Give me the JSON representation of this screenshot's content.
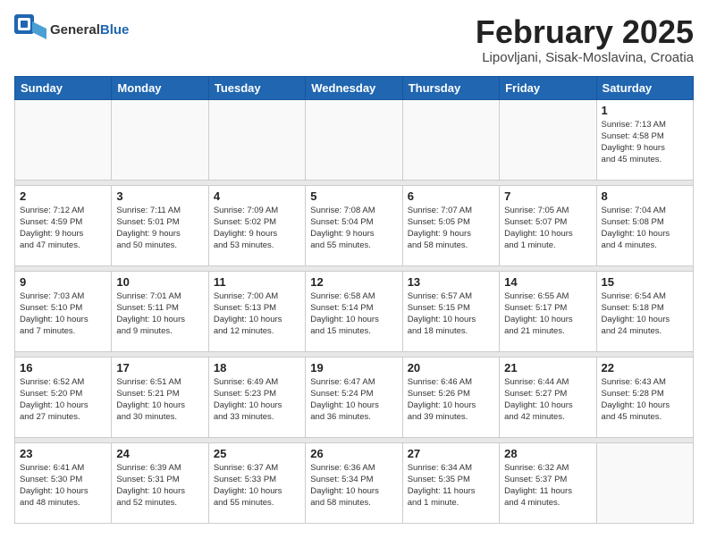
{
  "header": {
    "logo": {
      "general": "General",
      "blue": "Blue",
      "tagline": ""
    },
    "title": "February 2025",
    "subtitle": "Lipovljani, Sisak-Moslavina, Croatia"
  },
  "days_of_week": [
    "Sunday",
    "Monday",
    "Tuesday",
    "Wednesday",
    "Thursday",
    "Friday",
    "Saturday"
  ],
  "weeks": [
    {
      "days": [
        {
          "date": "",
          "info": ""
        },
        {
          "date": "",
          "info": ""
        },
        {
          "date": "",
          "info": ""
        },
        {
          "date": "",
          "info": ""
        },
        {
          "date": "",
          "info": ""
        },
        {
          "date": "",
          "info": ""
        },
        {
          "date": "1",
          "info": "Sunrise: 7:13 AM\nSunset: 4:58 PM\nDaylight: 9 hours\nand 45 minutes."
        }
      ]
    },
    {
      "days": [
        {
          "date": "2",
          "info": "Sunrise: 7:12 AM\nSunset: 4:59 PM\nDaylight: 9 hours\nand 47 minutes."
        },
        {
          "date": "3",
          "info": "Sunrise: 7:11 AM\nSunset: 5:01 PM\nDaylight: 9 hours\nand 50 minutes."
        },
        {
          "date": "4",
          "info": "Sunrise: 7:09 AM\nSunset: 5:02 PM\nDaylight: 9 hours\nand 53 minutes."
        },
        {
          "date": "5",
          "info": "Sunrise: 7:08 AM\nSunset: 5:04 PM\nDaylight: 9 hours\nand 55 minutes."
        },
        {
          "date": "6",
          "info": "Sunrise: 7:07 AM\nSunset: 5:05 PM\nDaylight: 9 hours\nand 58 minutes."
        },
        {
          "date": "7",
          "info": "Sunrise: 7:05 AM\nSunset: 5:07 PM\nDaylight: 10 hours\nand 1 minute."
        },
        {
          "date": "8",
          "info": "Sunrise: 7:04 AM\nSunset: 5:08 PM\nDaylight: 10 hours\nand 4 minutes."
        }
      ]
    },
    {
      "days": [
        {
          "date": "9",
          "info": "Sunrise: 7:03 AM\nSunset: 5:10 PM\nDaylight: 10 hours\nand 7 minutes."
        },
        {
          "date": "10",
          "info": "Sunrise: 7:01 AM\nSunset: 5:11 PM\nDaylight: 10 hours\nand 9 minutes."
        },
        {
          "date": "11",
          "info": "Sunrise: 7:00 AM\nSunset: 5:13 PM\nDaylight: 10 hours\nand 12 minutes."
        },
        {
          "date": "12",
          "info": "Sunrise: 6:58 AM\nSunset: 5:14 PM\nDaylight: 10 hours\nand 15 minutes."
        },
        {
          "date": "13",
          "info": "Sunrise: 6:57 AM\nSunset: 5:15 PM\nDaylight: 10 hours\nand 18 minutes."
        },
        {
          "date": "14",
          "info": "Sunrise: 6:55 AM\nSunset: 5:17 PM\nDaylight: 10 hours\nand 21 minutes."
        },
        {
          "date": "15",
          "info": "Sunrise: 6:54 AM\nSunset: 5:18 PM\nDaylight: 10 hours\nand 24 minutes."
        }
      ]
    },
    {
      "days": [
        {
          "date": "16",
          "info": "Sunrise: 6:52 AM\nSunset: 5:20 PM\nDaylight: 10 hours\nand 27 minutes."
        },
        {
          "date": "17",
          "info": "Sunrise: 6:51 AM\nSunset: 5:21 PM\nDaylight: 10 hours\nand 30 minutes."
        },
        {
          "date": "18",
          "info": "Sunrise: 6:49 AM\nSunset: 5:23 PM\nDaylight: 10 hours\nand 33 minutes."
        },
        {
          "date": "19",
          "info": "Sunrise: 6:47 AM\nSunset: 5:24 PM\nDaylight: 10 hours\nand 36 minutes."
        },
        {
          "date": "20",
          "info": "Sunrise: 6:46 AM\nSunset: 5:26 PM\nDaylight: 10 hours\nand 39 minutes."
        },
        {
          "date": "21",
          "info": "Sunrise: 6:44 AM\nSunset: 5:27 PM\nDaylight: 10 hours\nand 42 minutes."
        },
        {
          "date": "22",
          "info": "Sunrise: 6:43 AM\nSunset: 5:28 PM\nDaylight: 10 hours\nand 45 minutes."
        }
      ]
    },
    {
      "days": [
        {
          "date": "23",
          "info": "Sunrise: 6:41 AM\nSunset: 5:30 PM\nDaylight: 10 hours\nand 48 minutes."
        },
        {
          "date": "24",
          "info": "Sunrise: 6:39 AM\nSunset: 5:31 PM\nDaylight: 10 hours\nand 52 minutes."
        },
        {
          "date": "25",
          "info": "Sunrise: 6:37 AM\nSunset: 5:33 PM\nDaylight: 10 hours\nand 55 minutes."
        },
        {
          "date": "26",
          "info": "Sunrise: 6:36 AM\nSunset: 5:34 PM\nDaylight: 10 hours\nand 58 minutes."
        },
        {
          "date": "27",
          "info": "Sunrise: 6:34 AM\nSunset: 5:35 PM\nDaylight: 11 hours\nand 1 minute."
        },
        {
          "date": "28",
          "info": "Sunrise: 6:32 AM\nSunset: 5:37 PM\nDaylight: 11 hours\nand 4 minutes."
        },
        {
          "date": "",
          "info": ""
        }
      ]
    }
  ]
}
